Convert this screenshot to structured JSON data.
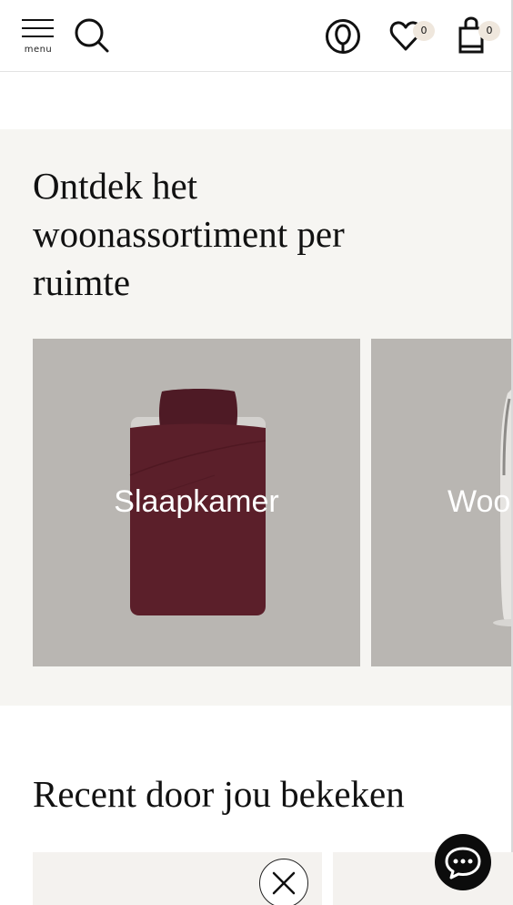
{
  "header": {
    "menu_label": "menu",
    "icons": [
      "menu-icon",
      "search-icon",
      "account-icon",
      "heart-icon",
      "shopping-bag-icon"
    ],
    "wishlist_count": "0",
    "bag_count": "0"
  },
  "rooms": {
    "title": "Ontdek het woonassortiment per ruimte",
    "cards": [
      {
        "label": "Slaapkamer",
        "image": "duvet-cover"
      },
      {
        "label": "Woonkamer",
        "image": "floor-lamp"
      }
    ]
  },
  "recent": {
    "title": "Recent door jou bekeken"
  },
  "colors": {
    "section_bg": "#f6f5f2",
    "card_bg": "#b9b6b2",
    "duvet": "#5b1f2a",
    "badge_bg": "#efe7dd",
    "chat_bg": "#0c0c0c"
  }
}
